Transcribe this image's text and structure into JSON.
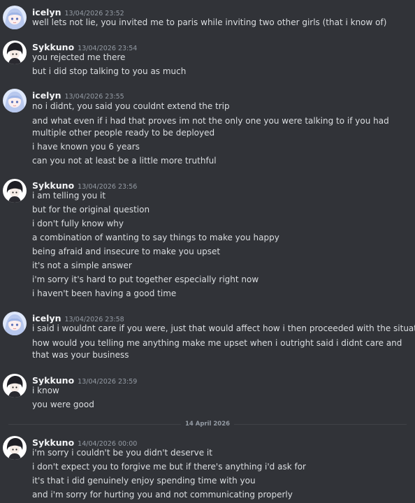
{
  "users": {
    "icelyn": {
      "name": "icelyn",
      "avatar_icon": "anime-girl-avatar-icon",
      "avatar_color": "#c9d6f2"
    },
    "sykkuno": {
      "name": "Sykkuno",
      "avatar_icon": "anime-boy-avatar-icon",
      "avatar_color": "#ffffff"
    }
  },
  "date_divider": {
    "label": "14 April 2026"
  },
  "messages": [
    {
      "author": "icelyn",
      "timestamp": "13/04/2026 23:52",
      "lines": [
        "well lets not lie, you invited me to paris while inviting two other girls (that i know of)"
      ]
    },
    {
      "author": "Sykkuno",
      "timestamp": "13/04/2026 23:54",
      "lines": [
        "you rejected me there",
        "but i did stop talking to you as much"
      ]
    },
    {
      "author": "icelyn",
      "timestamp": "13/04/2026 23:55",
      "lines": [
        "no i didnt, you said you couldnt extend the trip",
        "and what even if i had that proves im not the only one you were talking to if you had multiple other people ready to be deployed",
        "i have known you 6 years",
        "can you not at least be a little more truthful"
      ]
    },
    {
      "author": "Sykkuno",
      "timestamp": "13/04/2026 23:56",
      "lines": [
        "i am telling you it",
        "but for the original question",
        "i don't fully know why",
        "a combination of wanting to say things to make you happy",
        "being afraid and insecure to make you upset",
        "it's not a simple answer",
        "i'm sorry it's hard to put together especially right now",
        "i haven't been having a good time"
      ]
    },
    {
      "author": "icelyn",
      "timestamp": "13/04/2026 23:58",
      "lines": [
        "i said i wouldnt care if you were, just that would affect how i then proceeded with the situation",
        "how would you telling me anything make me upset when i outright said i didnt care and that was your business"
      ]
    },
    {
      "author": "Sykkuno",
      "timestamp": "13/04/2026 23:59",
      "lines": [
        "i know",
        "you were good"
      ]
    },
    {
      "author": "Sykkuno",
      "timestamp": "14/04/2026 00:00",
      "lines": [
        "i'm sorry i couldn't be you didn't deserve it",
        "i don't expect you to forgive me but if there's anything i'd ask for",
        "it's that i did genuinely enjoy spending time with you",
        "and i'm sorry for hurting you and not communicating properly"
      ]
    }
  ]
}
